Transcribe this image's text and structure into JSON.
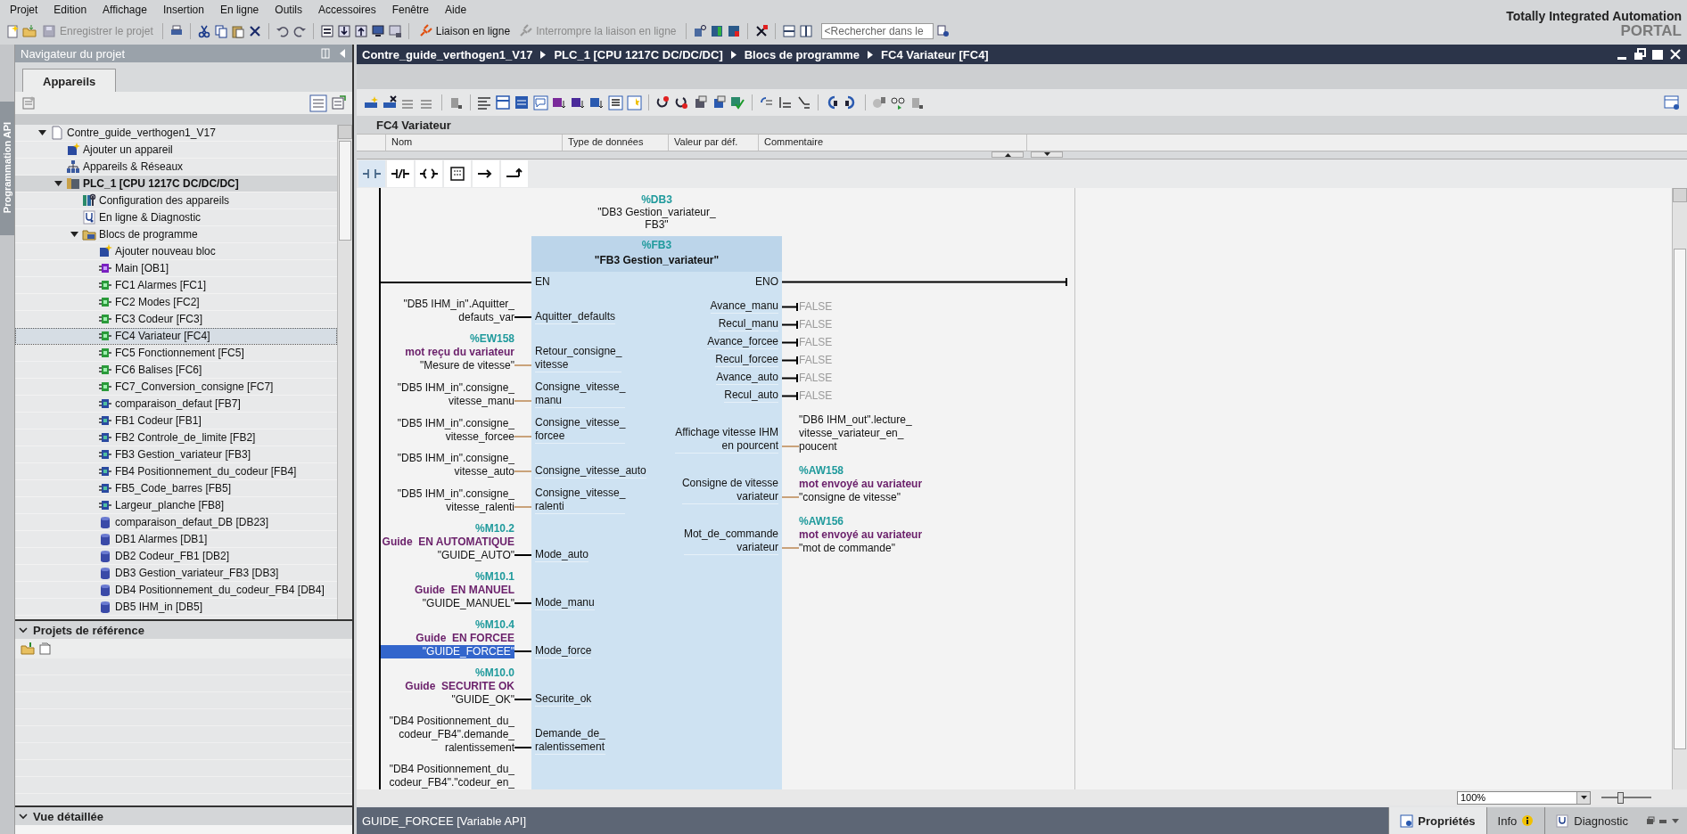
{
  "menu": [
    "Projet",
    "Edition",
    "Affichage",
    "Insertion",
    "En ligne",
    "Outils",
    "Accessoires",
    "Fenêtre",
    "Aide"
  ],
  "toolbar": {
    "save": {
      "label": "Enregistrer le projet",
      "disabled": true
    },
    "go_online": {
      "label": "Liaison en ligne",
      "disabled": false
    },
    "go_offline": {
      "label": "Interrompre la liaison en ligne",
      "disabled": true
    },
    "search": {
      "placeholder": "<Rechercher dans le"
    }
  },
  "branding": {
    "line_1": "Totally Integrated Automation",
    "line_2": "PORTAL"
  },
  "side_strip": {
    "label": "Programmation API"
  },
  "navigator": {
    "title": "Navigateur du projet",
    "tabs": [
      {
        "label": "Appareils",
        "selected": true
      }
    ],
    "tree": [
      {
        "label": "Contre_guide_verthogen1_V17",
        "kind": "project",
        "expanded": true,
        "selected": false,
        "children": [
          {
            "label": "Ajouter un appareil",
            "kind": "add",
            "selected": false
          },
          {
            "label": "Appareils & Réseaux",
            "kind": "network",
            "selected": false
          },
          {
            "label": "PLC_1 [CPU 1217C DC/DC/DC]",
            "kind": "plc",
            "expanded": true,
            "selected": false,
            "children": [
              {
                "label": "Configuration des appareils",
                "kind": "config",
                "selected": false
              },
              {
                "label": "En ligne & Diagnostic",
                "kind": "diagnostic",
                "selected": false
              },
              {
                "label": "Blocs de programme",
                "kind": "folder",
                "expanded": true,
                "selected": false,
                "children": [
                  {
                    "label": "Ajouter nouveau bloc",
                    "kind": "add",
                    "selected": false
                  },
                  {
                    "label": "Main [OB1]",
                    "kind": "ob",
                    "selected": false
                  },
                  {
                    "label": "FC1 Alarmes [FC1]",
                    "kind": "fc",
                    "selected": false
                  },
                  {
                    "label": "FC2 Modes [FC2]",
                    "kind": "fc",
                    "selected": false
                  },
                  {
                    "label": "FC3 Codeur [FC3]",
                    "kind": "fc",
                    "selected": false
                  },
                  {
                    "label": "FC4 Variateur [FC4]",
                    "kind": "fc",
                    "selected": true
                  },
                  {
                    "label": "FC5 Fonctionnement [FC5]",
                    "kind": "fc",
                    "selected": false
                  },
                  {
                    "label": "FC6 Balises [FC6]",
                    "kind": "fc",
                    "selected": false
                  },
                  {
                    "label": "FC7_Conversion_consigne [FC7]",
                    "kind": "fc",
                    "selected": false
                  },
                  {
                    "label": "comparaison_defaut [FB7]",
                    "kind": "fb",
                    "selected": false
                  },
                  {
                    "label": "FB1 Codeur [FB1]",
                    "kind": "fb",
                    "selected": false
                  },
                  {
                    "label": "FB2 Controle_de_limite [FB2]",
                    "kind": "fb",
                    "selected": false
                  },
                  {
                    "label": "FB3 Gestion_variateur [FB3]",
                    "kind": "fb",
                    "selected": false
                  },
                  {
                    "label": "FB4 Positionnement_du_codeur [FB4]",
                    "kind": "fb",
                    "selected": false
                  },
                  {
                    "label": "FB5_Code_barres [FB5]",
                    "kind": "fb",
                    "selected": false
                  },
                  {
                    "label": "Largeur_planche [FB8]",
                    "kind": "fb",
                    "selected": false
                  },
                  {
                    "label": "comparaison_defaut_DB [DB23]",
                    "kind": "db",
                    "selected": false
                  },
                  {
                    "label": "DB1 Alarmes [DB1]",
                    "kind": "db",
                    "selected": false
                  },
                  {
                    "label": "DB2 Codeur_FB1 [DB2]",
                    "kind": "db",
                    "selected": false
                  },
                  {
                    "label": "DB3 Gestion_variateur_FB3 [DB3]",
                    "kind": "db",
                    "selected": false
                  },
                  {
                    "label": "DB4 Positionnement_du_codeur_FB4 [DB4]",
                    "kind": "db",
                    "selected": false
                  },
                  {
                    "label": "DB5 IHM_in [DB5]",
                    "kind": "db",
                    "selected": false
                  }
                ]
              }
            ]
          }
        ]
      }
    ]
  },
  "reference_projects": {
    "title": "Projets de référence",
    "expanded": true
  },
  "detail_view": {
    "title": "Vue détaillée",
    "expanded": true
  },
  "editor": {
    "breadcrumb": [
      "Contre_guide_verthogen1_V17",
      "PLC_1 [CPU 1217C DC/DC/DC]",
      "Blocs de programme",
      "FC4 Variateur [FC4]"
    ],
    "block_title": "FC4 Variateur",
    "interface_columns": [
      "Nom",
      "Type de données",
      "Valeur par déf.",
      "Commentaire"
    ],
    "network": {
      "instance": {
        "address": "%DB3",
        "name": "\"DB3 Gestion_variateur_\nFB3\""
      },
      "block": {
        "address": "%FB3",
        "name": "\"FB3 Gestion_variateur\""
      },
      "en": "EN",
      "eno": "ENO",
      "inputs": [
        {
          "kind": "bool",
          "symbol": "\"DB5 IHM_in\".Aquitter_\ndefauts_var",
          "pin": "Aquitter_defaults",
          "selected": false
        },
        {
          "kind": "value",
          "address": "%EW158",
          "comment": "mot reçu du variateur",
          "symbol": "\"Mesure de vitesse\"",
          "pin": "Retour_consigne_\nvitesse",
          "selected": false
        },
        {
          "kind": "value",
          "symbol": "\"DB5 IHM_in\".consigne_\nvitesse_manu",
          "pin": "Consigne_vitesse_\nmanu",
          "selected": false
        },
        {
          "kind": "value",
          "symbol": "\"DB5 IHM_in\".consigne_\nvitesse_forcee",
          "pin": "Consigne_vitesse_\nforcee",
          "selected": false
        },
        {
          "kind": "value",
          "symbol": "\"DB5 IHM_in\".consigne_\nvitesse_auto",
          "pin": "Consigne_vitesse_auto",
          "selected": false
        },
        {
          "kind": "value",
          "symbol": "\"DB5 IHM_in\".consigne_\nvitesse_ralenti",
          "pin": "Consigne_vitesse_\nralenti",
          "selected": false
        },
        {
          "kind": "bool",
          "address": "%M10.2",
          "comment": "Guide  EN AUTOMATIQUE",
          "symbol": "\"GUIDE_AUTO\"",
          "pin": "Mode_auto",
          "selected": false
        },
        {
          "kind": "bool",
          "address": "%M10.1",
          "comment": "Guide  EN MANUEL",
          "symbol": "\"GUIDE_MANUEL\"",
          "pin": "Mode_manu",
          "selected": false
        },
        {
          "kind": "bool",
          "address": "%M10.4",
          "comment": "Guide  EN FORCEE",
          "symbol": "\"GUIDE_FORCEE\"",
          "pin": "Mode_force",
          "selected": true
        },
        {
          "kind": "bool",
          "address": "%M10.0",
          "comment": "Guide  SECURITE OK",
          "symbol": "\"GUIDE_OK\"",
          "pin": "Securite_ok",
          "selected": false
        },
        {
          "kind": "bool",
          "symbol": "\"DB4 Positionnement_du_\ncodeur_FB4\".demande_\nralentissement",
          "pin": "Demande_de_\nralentissement",
          "selected": false
        },
        {
          "kind": "cut",
          "symbol": "\"DB4 Positionnement_du_\ncodeur_FB4\".\"codeur_en_",
          "selected": false
        }
      ],
      "outputs": [
        {
          "kind": "bool",
          "pin": "Avance_manu",
          "value": "FALSE"
        },
        {
          "kind": "bool",
          "pin": "Recul_manu",
          "value": "FALSE"
        },
        {
          "kind": "bool",
          "pin": "Avance_forcee",
          "value": "FALSE"
        },
        {
          "kind": "bool",
          "pin": "Recul_forcee",
          "value": "FALSE"
        },
        {
          "kind": "bool",
          "pin": "Avance_auto",
          "value": "FALSE"
        },
        {
          "kind": "bool",
          "pin": "Recul_auto",
          "value": "FALSE"
        },
        {
          "kind": "value",
          "pin": "Affichage vitesse IHM\nen pourcent",
          "symbol": "\"DB6 IHM_out\".lecture_\nvitesse_variateur_en_\npoucent"
        },
        {
          "kind": "value",
          "pin": "Consigne de vitesse\nvariateur",
          "address": "%AW158",
          "comment": "mot envoyé au variateur",
          "symbol": "\"consigne de vitesse\""
        },
        {
          "kind": "value",
          "pin": "Mot_de_commande\nvariateur",
          "address": "%AW156",
          "comment": "mot envoyé au variateur",
          "symbol": "\"mot de commande\""
        }
      ]
    },
    "zoom": {
      "value": "100%",
      "level": 0.35
    }
  },
  "status_bar": {
    "object": "GUIDE_FORCEE [Variable API]",
    "tabs": [
      {
        "label": "Propriétés",
        "kind": "properties",
        "selected": true
      },
      {
        "label": "Info",
        "kind": "info",
        "selected": false
      },
      {
        "label": "Diagnostic",
        "kind": "diagnostic",
        "selected": false
      }
    ]
  }
}
